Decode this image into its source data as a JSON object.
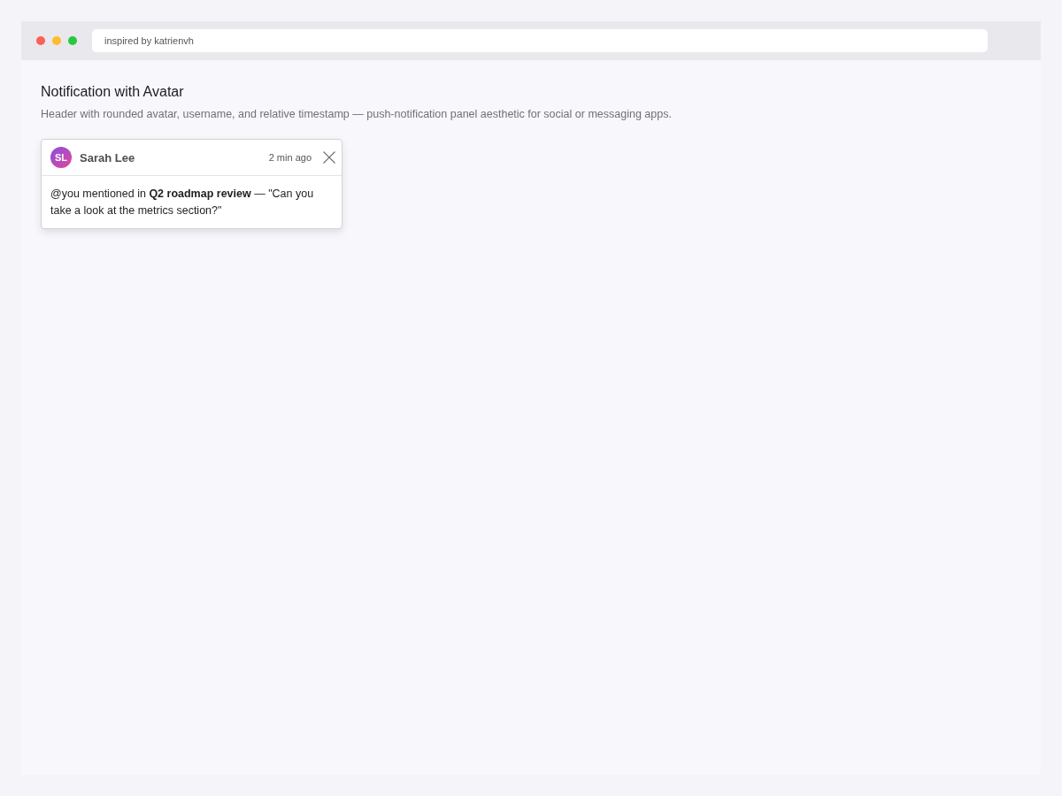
{
  "browser": {
    "address": "inspired by katrienvh"
  },
  "heading": "Notification with Avatar",
  "description": "Header with rounded avatar, username, and relative timestamp — push-notification panel aesthetic for social or messaging apps.",
  "notification": {
    "avatar_initials": "SL",
    "username": "Sarah Lee",
    "timestamp": "2 min ago",
    "message": "@you mentioned in **Q2 roadmap review** — \"Can you take a look at the metrics section?\""
  }
}
